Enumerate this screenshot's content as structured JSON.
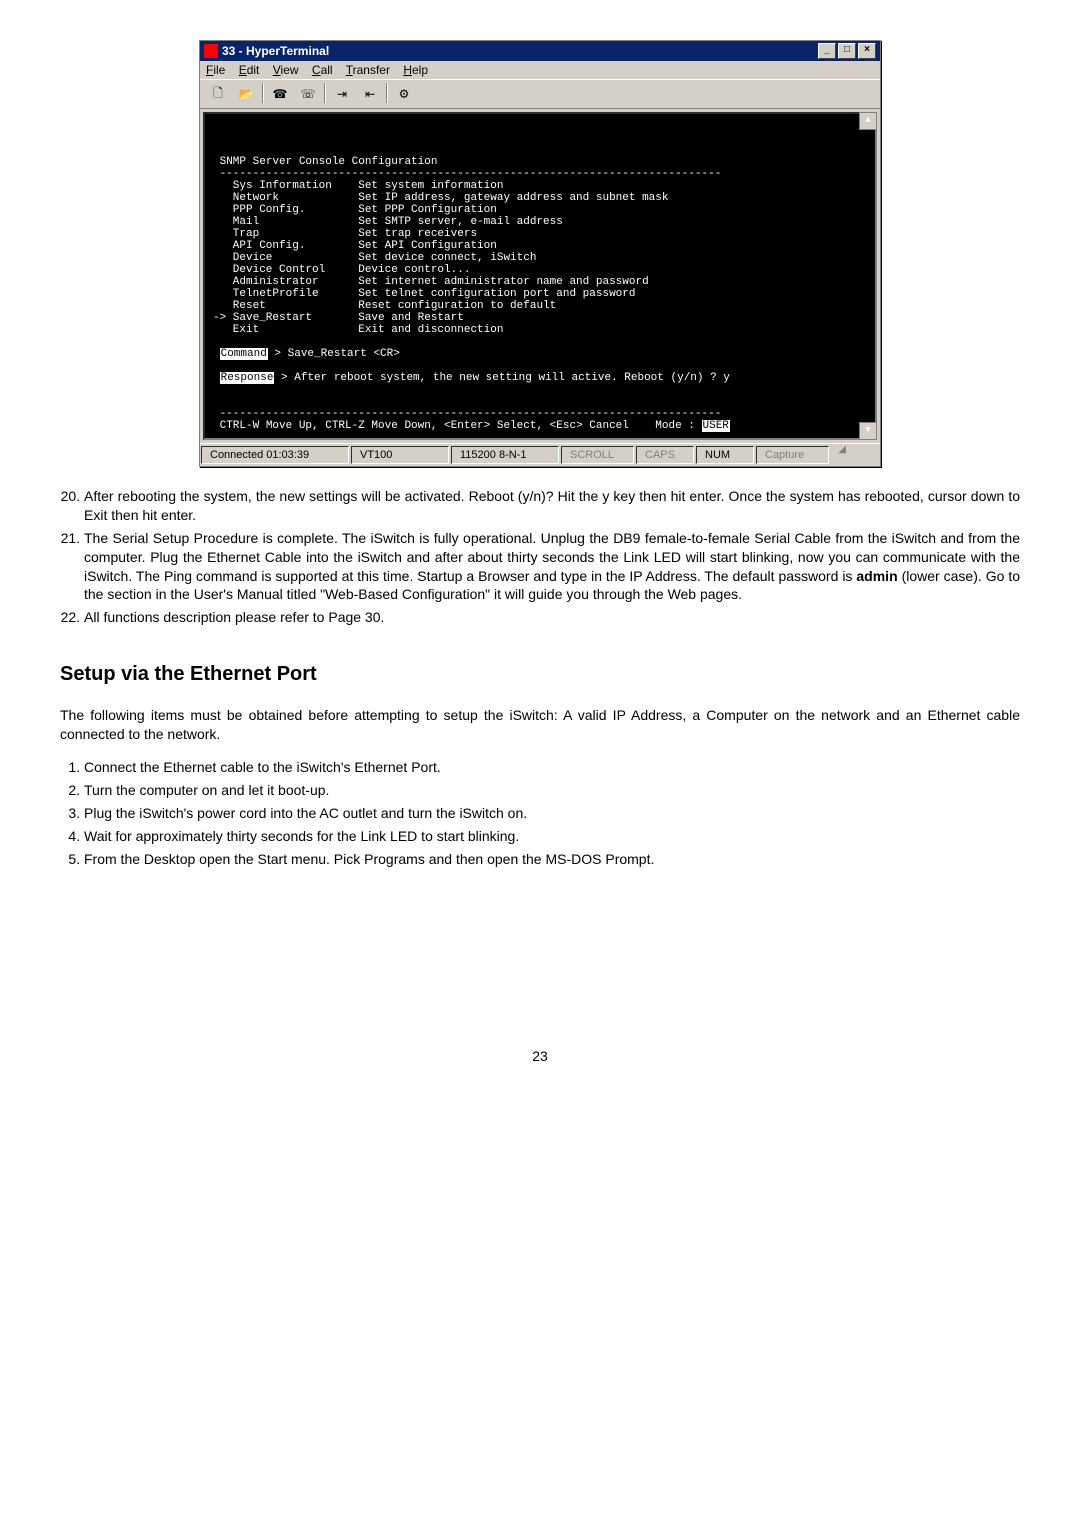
{
  "window": {
    "title": "33 - HyperTerminal",
    "menu": {
      "file": "File",
      "edit": "Edit",
      "view": "View",
      "call": "Call",
      "transfer": "Transfer",
      "help": "Help"
    },
    "terminal": {
      "header": "SNMP Server Console Configuration",
      "sep": "----------------------------------------------------------------------------",
      "rows": [
        {
          "l": "   Sys Information",
          "r": "Set system information"
        },
        {
          "l": "   Network",
          "r": "Set IP address, gateway address and subnet mask"
        },
        {
          "l": "   PPP Config.",
          "r": "Set PPP Configuration"
        },
        {
          "l": "   Mail",
          "r": "Set SMTP server, e-mail address"
        },
        {
          "l": "   Trap",
          "r": "Set trap receivers"
        },
        {
          "l": "   API Config.",
          "r": "Set API Configuration"
        },
        {
          "l": "   Device",
          "r": "Set device connect, iSwitch"
        },
        {
          "l": "   Device Control",
          "r": "Device control..."
        },
        {
          "l": "   Administrator",
          "r": "Set internet administrator name and password"
        },
        {
          "l": "   TelnetProfile",
          "r": "Set telnet configuration port and password"
        },
        {
          "l": "   Reset",
          "r": "Reset configuration to default"
        },
        {
          "l": "-> Save_Restart",
          "r": "Save and Restart"
        },
        {
          "l": "   Exit",
          "r": "Exit and disconnection"
        }
      ],
      "command_lbl": "Command",
      "command_txt": " > Save_Restart <CR>",
      "response_lbl": "Response",
      "response_txt": " > After reboot system, the new setting will active. Reboot (y/n) ? y",
      "footer_left": "CTRL-W Move Up, CTRL-Z Move Down, <Enter> Select, <Esc> Cancel    Mode : ",
      "footer_mode": "USER"
    },
    "status": {
      "connected": "Connected 01:03:39",
      "term": "VT100",
      "baud": "115200 8-N-1",
      "scroll": "SCROLL",
      "caps": "CAPS",
      "num": "NUM",
      "capture": "Capture"
    }
  },
  "doc": {
    "list1": {
      "start": 20,
      "items": [
        "After rebooting the system, the new settings will be activated.  Reboot (y/n)?  Hit the y key then hit enter.  Once the system has rebooted, cursor down to Exit then hit enter.",
        "The Serial Setup Procedure is complete.  The iSwitch is fully operational.  Unplug the DB9 female-to-female Serial Cable from the iSwitch and from the computer.  Plug the Ethernet Cable into the iSwitch and after about thirty seconds the Link LED will start blinking, now you can communicate with the iSwitch.  The Ping command is supported at this time.  Startup a Browser and type in the IP Address.  The default password is admin (lower case).  Go to the section in the User's Manual titled \"Web-Based Configuration\" it will guide you through the Web pages.",
        "All functions description please refer to Page 30."
      ]
    },
    "section_heading": "Setup via the Ethernet Port",
    "para1": "The following items must be obtained before attempting to setup the iSwitch:  A valid IP Address, a Computer on the network and an Ethernet cable connected to the network.",
    "list2": {
      "start": 1,
      "items": [
        "Connect the Ethernet cable to the iSwitch's Ethernet Port.",
        "Turn the computer on and let it boot-up.",
        "Plug the iSwitch's power cord into the AC outlet and turn the iSwitch on.",
        "Wait for approximately thirty seconds for the Link LED to start blinking.",
        "From the Desktop open the Start menu.  Pick Programs and then open the MS-DOS Prompt."
      ]
    },
    "page_number": "23"
  }
}
